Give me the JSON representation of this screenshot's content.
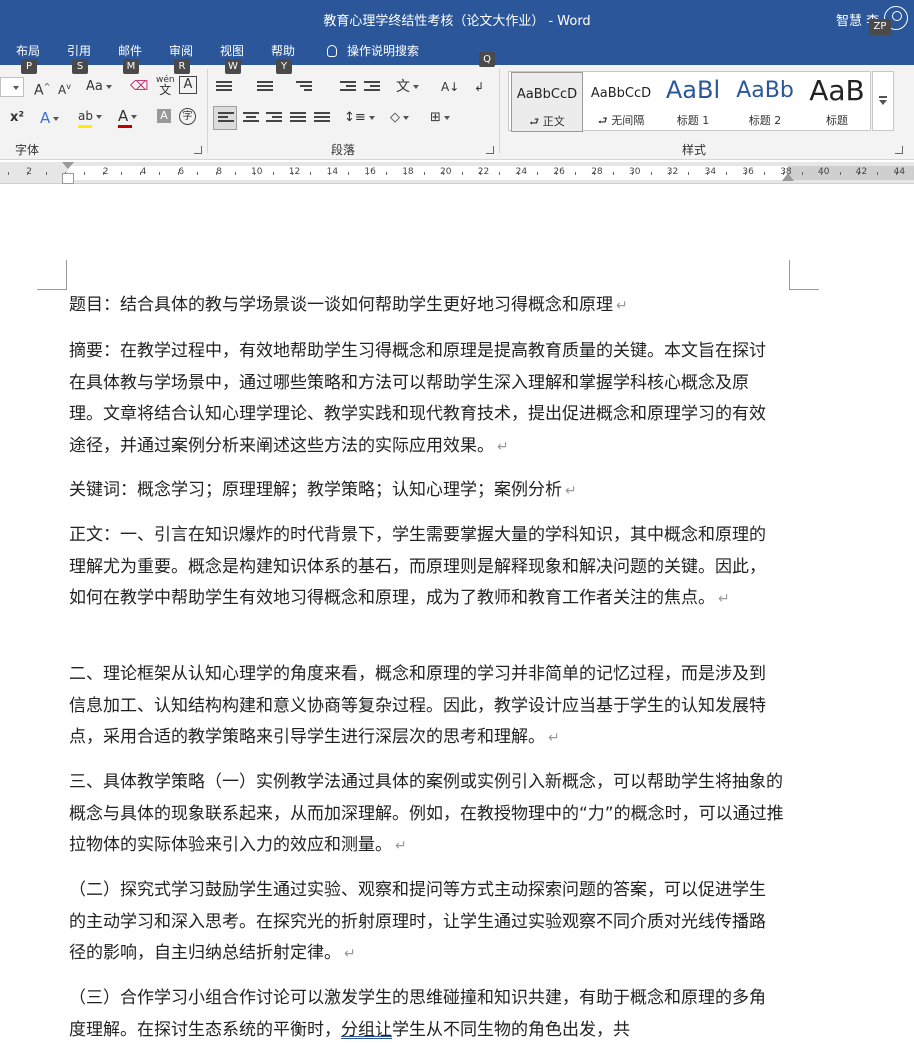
{
  "window": {
    "title": "教育心理学终结性考核（论文大作业）  -  Word",
    "user_name": "智慧 李",
    "user_badge": "ZP"
  },
  "tabs": [
    {
      "label": "布局",
      "keytip": "P"
    },
    {
      "label": "引用",
      "keytip": "S"
    },
    {
      "label": "邮件",
      "keytip": "M"
    },
    {
      "label": "审阅",
      "keytip": "R"
    },
    {
      "label": "视图",
      "keytip": "W"
    },
    {
      "label": "帮助",
      "keytip": "Y"
    }
  ],
  "tell_me": {
    "label": "操作说明搜索",
    "keytip": "Q"
  },
  "ribbon": {
    "font_group_label": "字体",
    "paragraph_group_label": "段落",
    "styles_group_label": "样式",
    "font": {
      "grow_label": "A",
      "shrink_label": "A",
      "case_label": "Aa",
      "phonetic_label": "wén",
      "phonetic_char": "文",
      "border_char_label": "A",
      "superscript_label": "x²",
      "text_effect_label": "A",
      "highlight_label": "ab",
      "font_color_label": "A",
      "char_shading_label": "A",
      "enclose_char_label": "字"
    },
    "styles": [
      {
        "sample": "AaBbCcD",
        "name": "正文",
        "active": true,
        "kind": "body"
      },
      {
        "sample": "AaBbCcD",
        "name": "无间隔",
        "active": false,
        "kind": "body"
      },
      {
        "sample": "AaBl",
        "name": "标题 1",
        "active": false,
        "kind": "heading"
      },
      {
        "sample": "AaBb",
        "name": "标题 2",
        "active": false,
        "kind": "heading"
      },
      {
        "sample": "AaB",
        "name": "标题",
        "active": false,
        "kind": "title"
      }
    ]
  },
  "ruler": {
    "left_labels": [
      "2"
    ],
    "labels": [
      "2",
      "4",
      "6",
      "8",
      "10",
      "12",
      "14",
      "16",
      "18",
      "20",
      "22",
      "24",
      "26",
      "28",
      "30",
      "32",
      "34",
      "36",
      "38",
      "40",
      "42",
      "44"
    ]
  },
  "document": {
    "paragraphs": [
      {
        "text": "题目：结合具体的教与学场景谈一谈如何帮助学生更好地习得概念和原理"
      },
      {
        "text": "摘要：在教学过程中，有效地帮助学生习得概念和原理是提高教育质量的关键。本文旨在探讨在具体教与学场景中，通过哪些策略和方法可以帮助学生深入理解和掌握学科核心概念及原理。文章将结合认知心理学理论、教学实践和现代教育技术，提出促进概念和原理学习的有效途径，并通过案例分析来阐述这些方法的实际应用效果。"
      },
      {
        "text": "关键词：概念学习；原理理解；教学策略；认知心理学；案例分析"
      },
      {
        "text": "正文：一、引言在知识爆炸的时代背景下，学生需要掌握大量的学科知识，其中概念和原理的理解尤为重要。概念是构建知识体系的基石，而原理则是解释现象和解决问题的关键。因此，如何在教学中帮助学生有效地习得概念和原理，成为了教师和教育工作者关注的焦点。"
      },
      {
        "text": "二、理论框架从认知心理学的角度来看，概念和原理的学习并非简单的记忆过程，而是涉及到信息加工、认知结构构建和意义协商等复杂过程。因此，教学设计应当基于学生的认知发展特点，采用合适的教学策略来引导学生进行深层次的思考和理解。"
      },
      {
        "text": "三、具体教学策略（一）实例教学法通过具体的案例或实例引入新概念，可以帮助学生将抽象的概念与具体的现象联系起来，从而加深理解。例如，在教授物理中的“力”的概念时，可以通过推拉物体的实际体验来引入力的效应和测量。"
      },
      {
        "text": "（二）探究式学习鼓励学生通过实验、观察和提问等方式主动探索问题的答案，可以促进学生的主动学习和深入思考。在探究光的折射原理时，让学生通过实验观察不同介质对光线传播路径的影响，自主归纳总结折射定律。"
      },
      {
        "text_before": "（三）合作学习小组合作讨论可以激发学生的思维碰撞和知识共建，有助于概念和原理的多角度理解。在探讨生态系统的平衡时，",
        "text_marked": "分组让",
        "text_after": "学生从不同生物的角色出发，共"
      }
    ],
    "pilcrow": "↵"
  }
}
